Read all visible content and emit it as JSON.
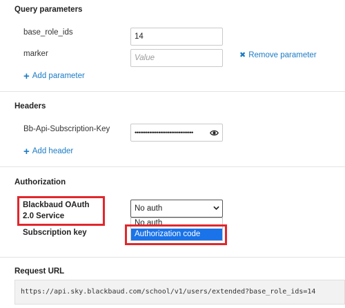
{
  "query_parameters": {
    "title": "Query parameters",
    "params": [
      {
        "name": "base_role_ids",
        "value": "14",
        "placeholder": ""
      },
      {
        "name": "marker",
        "value": "",
        "placeholder": "Value"
      }
    ],
    "remove_label": "Remove parameter",
    "add_label": "Add parameter"
  },
  "headers": {
    "title": "Headers",
    "items": [
      {
        "name": "Bb-Api-Subscription-Key",
        "masked_value": "••••••••••••••••••••••••••••••••"
      }
    ],
    "add_label": "Add header"
  },
  "authorization": {
    "title": "Authorization",
    "service_label": "Blackbaud OAuth 2.0 Service",
    "subscription_key_label": "Subscription key",
    "selected": "No auth",
    "options": [
      "No auth",
      "Authorization code"
    ],
    "highlighted_option": "Authorization code"
  },
  "request_url": {
    "title": "Request URL",
    "value": "https://api.sky.blackbaud.com/school/v1/users/extended?base_role_ids=14"
  },
  "colors": {
    "link": "#1a7bc4",
    "highlight_box": "#e2262b",
    "option_selected_bg": "#1a73e8"
  }
}
